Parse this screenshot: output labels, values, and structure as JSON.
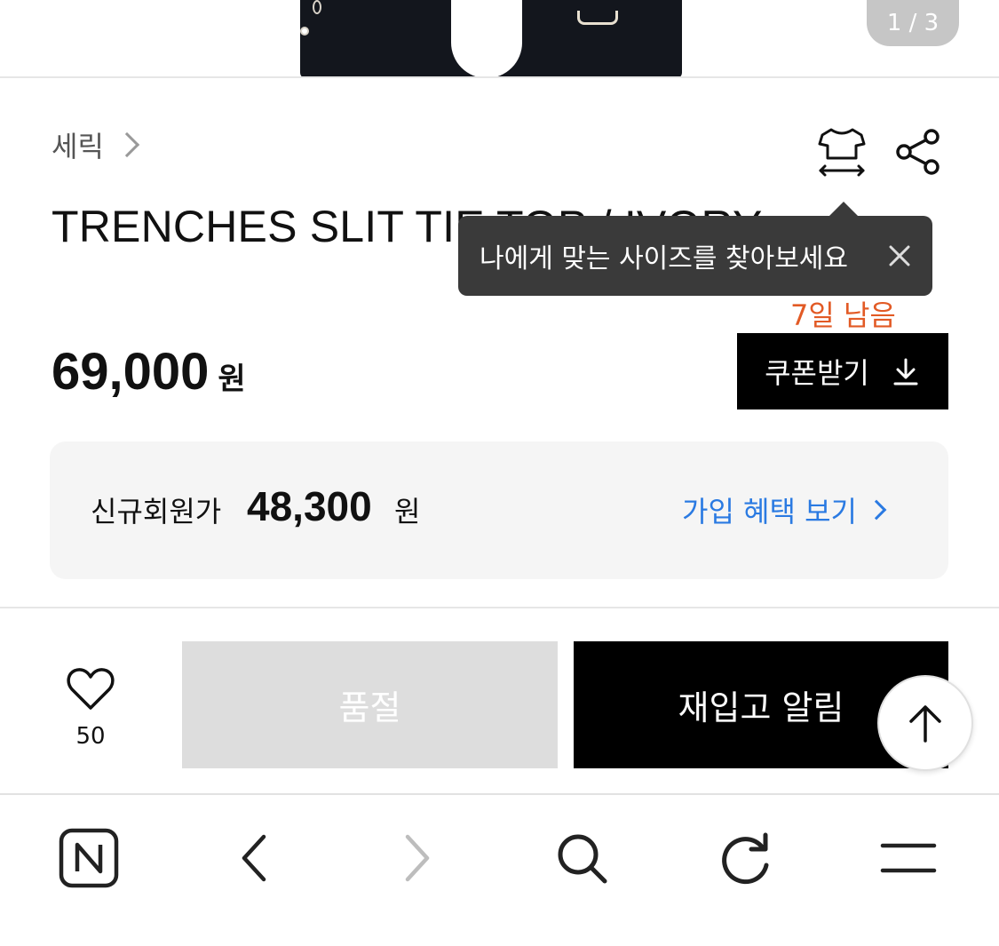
{
  "image_viewer": {
    "page_indicator": "1 / 3"
  },
  "product": {
    "brand": "세릭",
    "name": "TRENCHES SLIT TIE TOP / IVORY",
    "price": "69,000",
    "price_unit": "원",
    "coupon_days_left": "7일 남음",
    "coupon_button_label": "쿠폰받기"
  },
  "tooltip": {
    "text": "나에게 맞는 사이즈를 찾아보세요"
  },
  "member_offer": {
    "label": "신규회원가",
    "price": "48,300",
    "unit": "원",
    "link_label": "가입 혜택 보기"
  },
  "actions": {
    "like_count": "50",
    "soldout_label": "품절",
    "restock_label": "재입고 알림"
  },
  "colors": {
    "accent_orange": "#e25a25",
    "link_blue": "#2a7ae2",
    "tooltip_bg": "#3a3a3a"
  },
  "browser_bar": {
    "icons": [
      "naver-icon",
      "back-icon",
      "forward-icon",
      "search-icon",
      "refresh-icon",
      "menu-icon"
    ]
  }
}
